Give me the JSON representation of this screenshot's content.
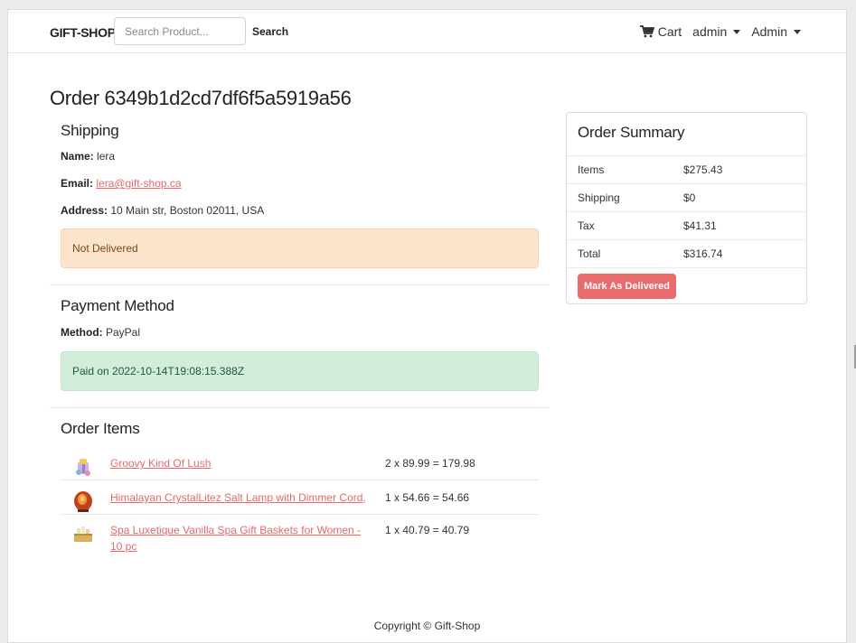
{
  "nav": {
    "brand": "GIFT-SHOP",
    "search_placeholder": "Search Product...",
    "search_button": "Search",
    "cart": "Cart",
    "user_menu": "admin",
    "admin_menu": "Admin"
  },
  "order": {
    "title": "Order 6349b1d2cd7df6f5a5919a56"
  },
  "shipping": {
    "heading": "Shipping",
    "name_label": "Name:",
    "name": "lera",
    "email_label": "Email:",
    "email": "lera@gift-shop.ca",
    "address_label": "Address:",
    "address": "10 Main str, Boston 02011, USA",
    "status": "Not Delivered"
  },
  "payment": {
    "heading": "Payment Method",
    "method_label": "Method:",
    "method": "PayPal",
    "status": "Paid on 2022-10-14T19:08:15.388Z"
  },
  "items": {
    "heading": "Order Items",
    "list": [
      {
        "name": "Groovy Kind Of Lush",
        "calc": "2 x 89.99 = 179.98",
        "icon": "gift-box-icon"
      },
      {
        "name": "Himalayan CrystalLitez Salt Lamp with Dimmer Cord,",
        "calc": "1 x 54.66 = 54.66",
        "icon": "salt-lamp-icon"
      },
      {
        "name": "Spa Luxetique Vanilla Spa Gift Baskets for Women - 10 pc",
        "calc": "1 x 40.79 = 40.79",
        "icon": "gift-basket-icon"
      }
    ]
  },
  "summary": {
    "heading": "Order Summary",
    "rows": [
      {
        "label": "Items",
        "value": "$275.43"
      },
      {
        "label": "Shipping",
        "value": "$0"
      },
      {
        "label": "Tax",
        "value": "$41.31"
      },
      {
        "label": "Total",
        "value": "$316.74"
      }
    ],
    "button": "Mark As Delivered"
  },
  "footer": {
    "text": "Copyright © Gift-Shop"
  },
  "colors": {
    "accent": "#e86c6c",
    "link": "#e46a6a",
    "warning_bg": "#fce3cc",
    "success_bg": "#d3eddb"
  }
}
